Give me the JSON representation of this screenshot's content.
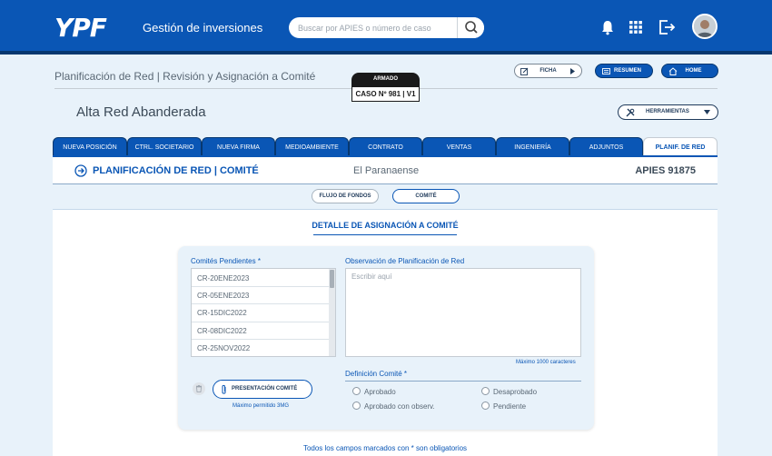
{
  "app": {
    "logo": "YPF",
    "title": "Gestión de inversiones",
    "search_placeholder": "Buscar por APIES o número de caso"
  },
  "header": {
    "breadcrumb": "Planificación de Red | Revisión y Asignación a Comité",
    "status_tab": "ARMADO",
    "case_label": "CASO Nº 981 | V1",
    "ficha_label": "FICHA",
    "resumen_label": "RESUMEN",
    "home_label": "HOME",
    "page_title": "Alta Red Abanderada",
    "tools_label": "HERRAMIENTAS"
  },
  "tabs": [
    {
      "label": "NUEVA POSICIÓN"
    },
    {
      "label": "CTRL. SOCIETARIO"
    },
    {
      "label": "NUEVA FIRMA"
    },
    {
      "label": "MEDIOAMBIENTE"
    },
    {
      "label": "CONTRATO"
    },
    {
      "label": "VENTAS"
    },
    {
      "label": "INGENIERÍA"
    },
    {
      "label": "ADJUNTOS"
    },
    {
      "label": "PLANIF. DE RED"
    }
  ],
  "section": {
    "title": "PLANIFICACIÓN DE RED | COMITÉ",
    "station": "El Paranaense",
    "apies": "APIES  91875"
  },
  "subtabs": [
    {
      "label": "FLUJO DE FONDOS"
    },
    {
      "label": "COMITÉ"
    }
  ],
  "detail_title": "DETALLE DE ASIGNACIÓN A COMITÉ",
  "form": {
    "pending_label": "Comités Pendientes *",
    "pending_items": [
      "CR-20ENE2023",
      "CR-05ENE2023",
      "CR-15DIC2022",
      "CR-08DIC2022",
      "CR-25NOV2022"
    ],
    "obs_label": "Observación de Planificación de Red",
    "obs_placeholder": "Escribir aquí",
    "max_chars": "Máximo 1000 caracteres",
    "definition_label": "Definición Comité *",
    "options": [
      "Aprobado",
      "Desaprobado",
      "Aprobado con observ.",
      "Pendiente"
    ],
    "presentation_label": "PRESENTACIÓN COMITÉ",
    "max_size": "Máximo permitido 3MG"
  },
  "footer_note": "Todos los campos marcados con * son obligatorios"
}
